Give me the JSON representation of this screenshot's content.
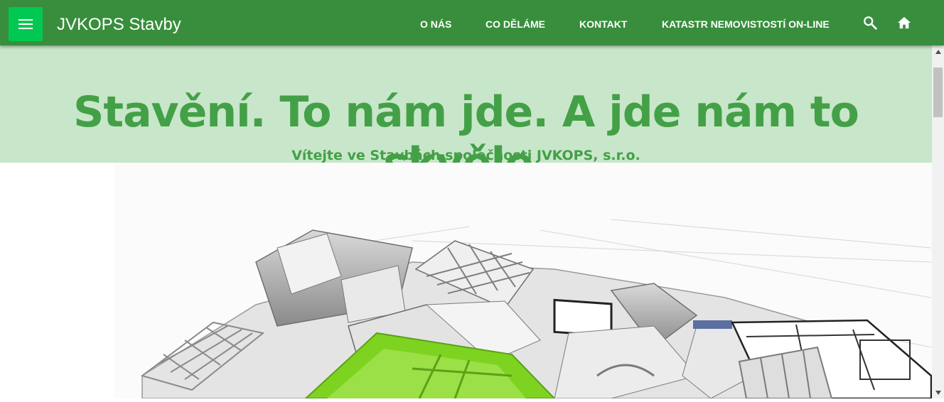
{
  "header": {
    "menu_icon": "hamburger-menu-icon",
    "brand": "JVKOPS Stavby",
    "nav": [
      {
        "label": "O NÁS"
      },
      {
        "label": "CO DĚLÁME"
      },
      {
        "label": "KONTAKT"
      },
      {
        "label": "KATASTR NEMOVISTOSTÍ ON-LINE"
      }
    ],
    "search_icon": "search-icon",
    "home_icon": "home-icon"
  },
  "hero": {
    "title": "Stavění. To nám jde. A jde nám to skvěle.",
    "subtitle": "Vítejte ve Stavbách společnosti JVKOPS, s.r.o."
  },
  "illustration": {
    "description_icon": "3d-floor-plan-image"
  },
  "colors": {
    "header_bg": "#388e3c",
    "menu_button_bg": "#00c853",
    "hero_bg": "#c8e6c9",
    "accent_green": "#43a047",
    "highlight_green": "#7ed321"
  }
}
